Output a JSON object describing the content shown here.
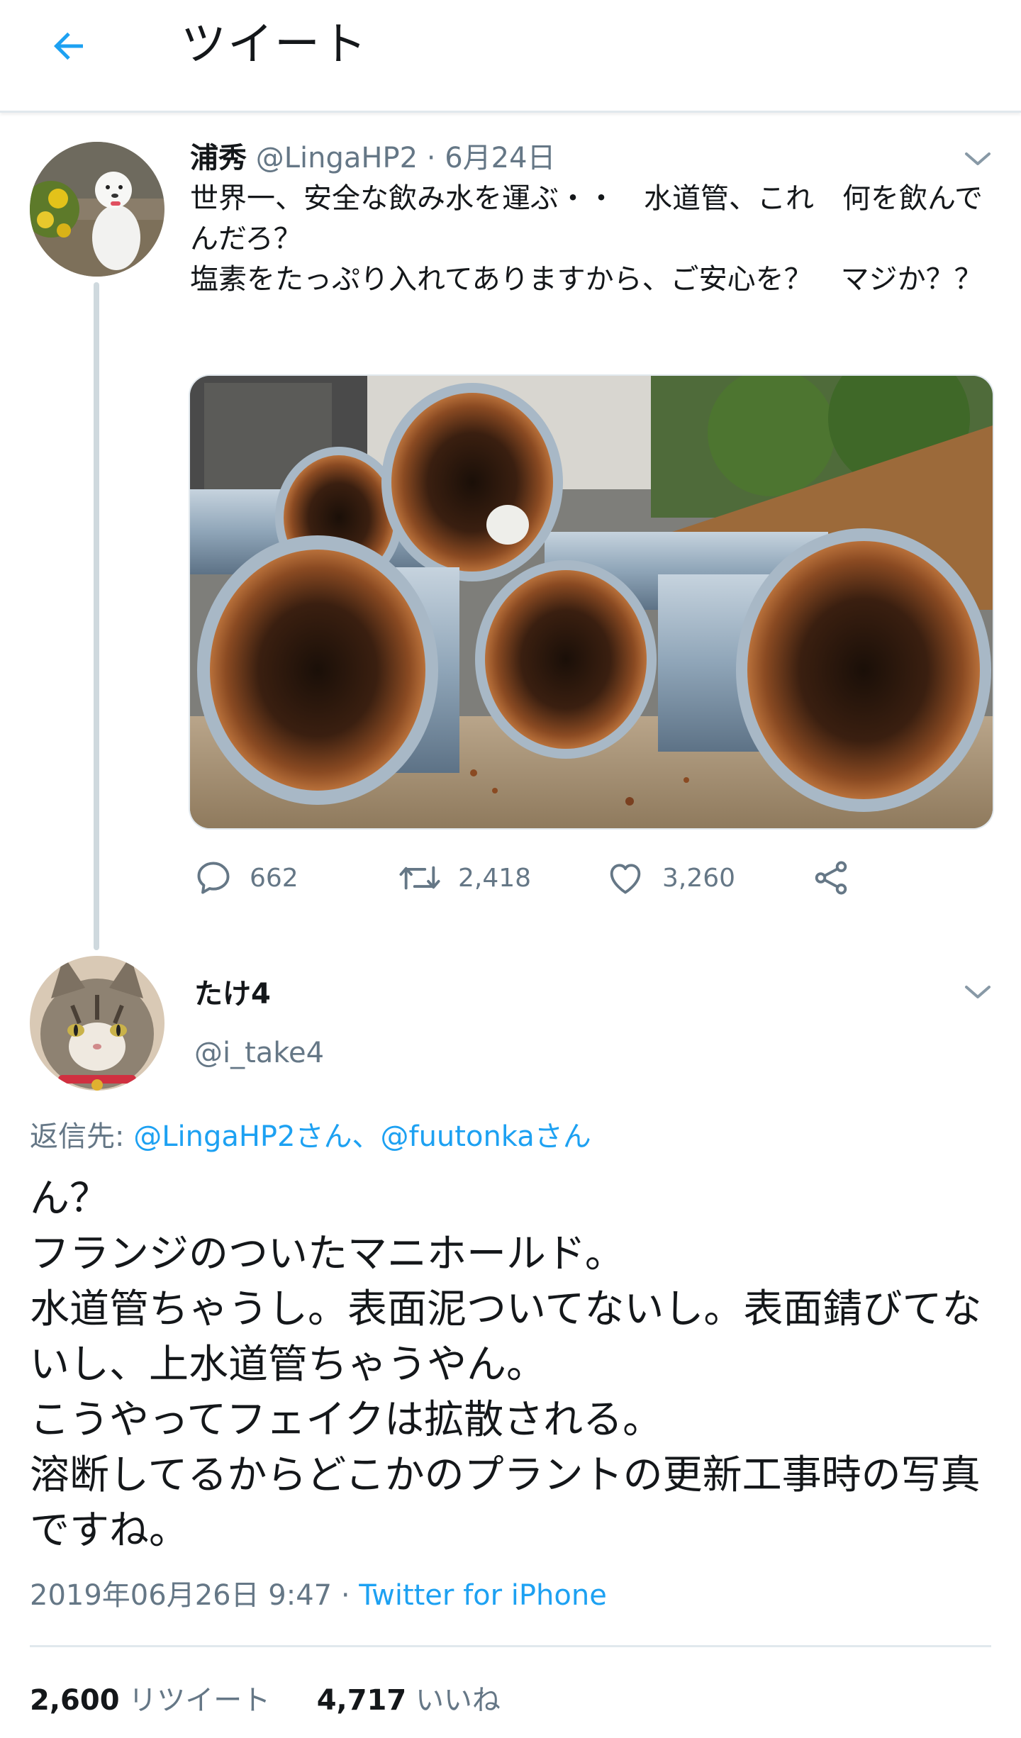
{
  "header": {
    "title": "ツイート"
  },
  "tweet1": {
    "name": "浦秀",
    "handle": "@LingaHP2",
    "separator": "·",
    "date": "6月24日",
    "text": "世界一、安全な飲み水を運ぶ・・　水道管、これ　何を飲んでんだろ？\n塩素をたっぷり入れてありますから、ご安心を？　マジか？？",
    "stats": {
      "replies": "662",
      "retweets": "2,418",
      "likes": "3,260"
    }
  },
  "tweet2": {
    "name": "たけ4",
    "handle": "@i_take4",
    "reply_prefix": "返信先:",
    "reply_to": "@LingaHP2さん、@fuutonkaさん",
    "text": "ん？\nフランジのついたマニホールド。\n水道管ちゃうし。表面泥ついてないし。表面錆びてないし、上水道管ちゃうやん。\nこうやってフェイクは拡散される。\n溶断してるからどこかのプラントの更新工事時の写真ですね。",
    "timestamp": "2019年06月26日 9:47",
    "meta_separator": "·",
    "source": "Twitter for iPhone",
    "retweet_count": "2,600",
    "retweet_label": "リツイート",
    "like_count": "4,717",
    "like_label": "いいね"
  },
  "icons": {
    "back": "arrow-left-icon",
    "more": "chevron-down-icon",
    "reply": "speech-bubble-icon",
    "retweet": "retweet-icon",
    "like": "heart-icon",
    "share": "share-icon"
  },
  "colors": {
    "accent": "#1da1f2",
    "muted": "#657786",
    "text": "#14171a",
    "border": "#e1e8ed"
  }
}
